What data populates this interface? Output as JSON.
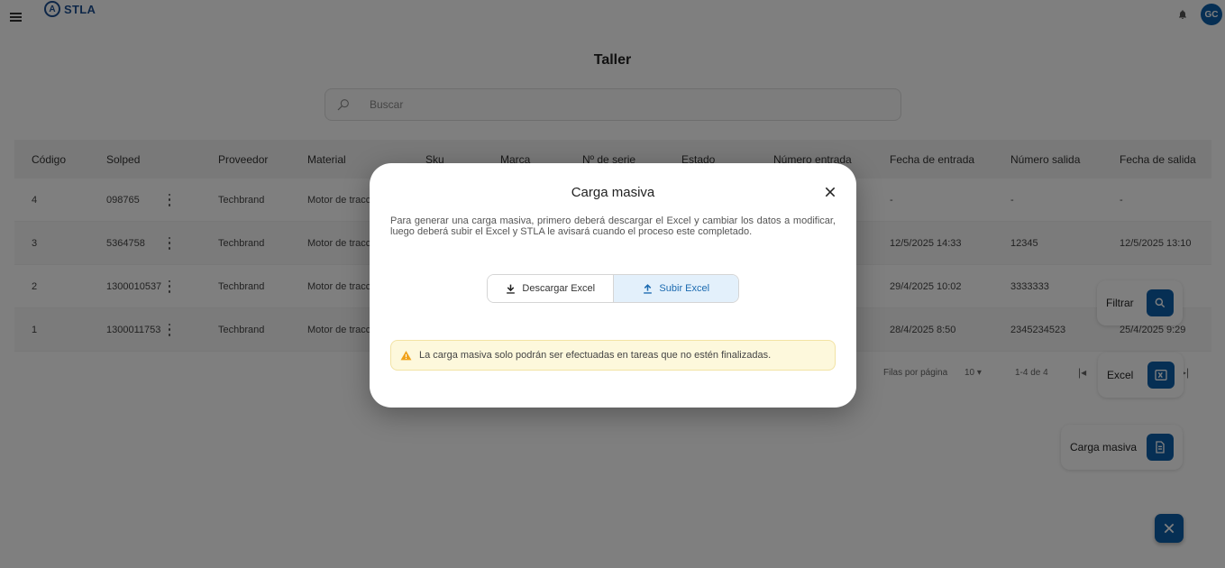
{
  "header": {
    "brand": "STLA",
    "brand_mark": "A",
    "avatar_initials": "GC",
    "icons": [
      "menu-icon",
      "bell-icon"
    ]
  },
  "page": {
    "title": "Taller"
  },
  "search": {
    "placeholder": "Buscar"
  },
  "table": {
    "columns": [
      "Código",
      "Solped",
      "Proveedor",
      "Material",
      "Sku",
      "Marca",
      "Nº de serie",
      "Estado",
      "Número entrada",
      "Fecha de entrada",
      "Número salida",
      "Fecha de salida"
    ],
    "rows": [
      {
        "codigo": "4",
        "solped": "098765",
        "proveedor": "Techbrand",
        "material": "Motor de tracc",
        "fecha_entrada": "-",
        "numero_salida": "-",
        "fecha_salida": "-"
      },
      {
        "codigo": "3",
        "solped": "5364758",
        "proveedor": "Techbrand",
        "material": "Motor de tracc",
        "fecha_entrada": "12/5/2025 14:33",
        "numero_salida": "12345",
        "fecha_salida": "12/5/2025 13:10"
      },
      {
        "codigo": "2",
        "solped": "1300010537",
        "proveedor": "Techbrand",
        "material": "Motor de tracc",
        "fecha_entrada": "29/4/2025 10:02",
        "numero_salida": "3333333",
        "fecha_salida": ""
      },
      {
        "codigo": "1",
        "solped": "1300011753",
        "proveedor": "Techbrand",
        "material": "Motor de tracc",
        "fecha_entrada": "28/4/2025 8:50",
        "numero_salida": "2345234523",
        "fecha_salida": "25/4/2025 9:29"
      }
    ]
  },
  "pagination": {
    "rows_per_page_label": "Filas por página",
    "rows_per_page": "10",
    "range": "1-4 de 4"
  },
  "fab_menu": {
    "filter_label": "Filtrar",
    "excel_label": "Excel",
    "bulk_label": "Carga masiva"
  },
  "modal": {
    "title": "Carga masiva",
    "description": "Para generar una carga masiva, primero deberá descargar el Excel y cambiar los datos a modificar, luego deberá subir el Excel y STLA le avisará cuando el proceso este completado.",
    "download_label": "Descargar Excel",
    "upload_label": "Subir Excel",
    "active_tab": "Subir Excel",
    "warning": "La carga masiva solo podrán ser efectuadas en tareas que no estén finalizadas."
  },
  "colors": {
    "primary": "#0d5fa8",
    "brand": "#1d4f91",
    "toggle_active_bg": "#e3f0fb",
    "warning_bg": "#fdf8dc",
    "warning_icon": "#f0a21a"
  }
}
